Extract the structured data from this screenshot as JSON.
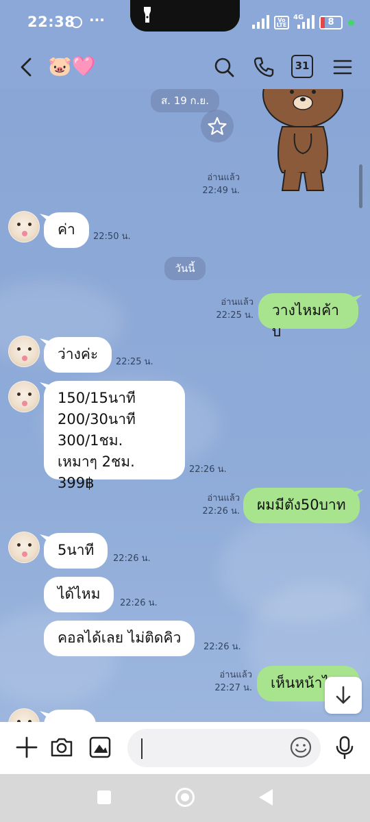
{
  "status_bar": {
    "time": "22:38",
    "dots": "···",
    "volte": "Vo LTE",
    "network": "4G",
    "battery": "8"
  },
  "header": {
    "title_emoji": "🐷🩷"
  },
  "chat": {
    "top_date": "ส. 19 ก.ย.",
    "sticker_read": "อ่านแล้ว",
    "sticker_time": "22:49 น.",
    "today_label": "วันนี้",
    "messages": [
      {
        "text": "ค่า",
        "time": "22:50 น."
      },
      {
        "text": "วางไหมค้าบ",
        "read": "อ่านแล้ว",
        "time": "22:25 น."
      },
      {
        "text": "ว่างค่ะ",
        "time": "22:25 น."
      },
      {
        "text": "150/15นาที\n200/30นาที\n300/1ชม.\nเหมาๆ 2ชม. 399฿",
        "time": "22:26 น."
      },
      {
        "text": "ผมมีตัง50บาท",
        "read": "อ่านแล้ว",
        "time": "22:26 น."
      },
      {
        "text": "5นาที",
        "time": "22:26 น."
      },
      {
        "text": "ได้ไหม",
        "time": "22:26 น."
      },
      {
        "text": "คอลได้เลย ไม่ติดคิว",
        "time": "22:26 น."
      },
      {
        "text": "เห็นหน้าไ",
        "read": "อ่านแล้ว",
        "time": "22:27 น."
      }
    ]
  },
  "input": {
    "placeholder": ""
  }
}
